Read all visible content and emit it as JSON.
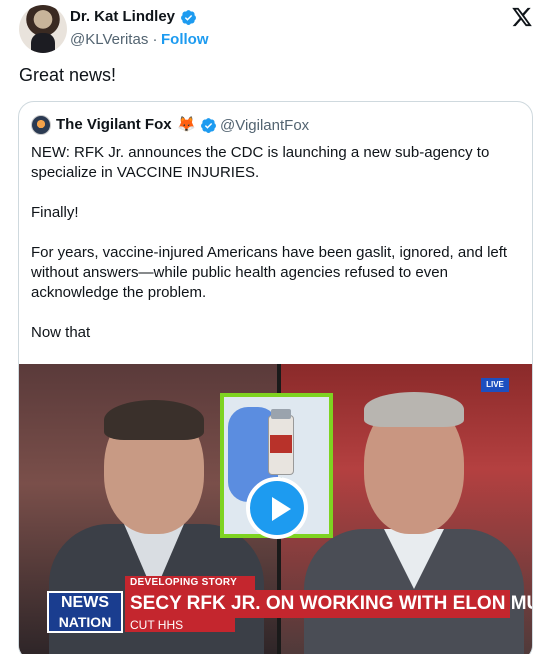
{
  "author": {
    "name": "Dr. Kat Lindley",
    "handle": "@KLVeritas",
    "separator": "·",
    "follow_label": "Follow"
  },
  "tweet": {
    "text": "Great news!"
  },
  "quoted": {
    "name": "The Vigilant Fox",
    "emoji": "🦊",
    "handle": "@VigilantFox",
    "paragraphs": [
      "NEW: RFK Jr. announces the CDC is launching a new sub-agency to specialize in VACCINE INJURIES.",
      "Finally!",
      "For years, vaccine-injured Americans have been gaslit, ignored, and left without answers—while public health agencies refused to even acknowledge the problem.",
      "Now that"
    ]
  },
  "video": {
    "live_badge": "LIVE",
    "chyron_top": "DEVELOPING STORY",
    "chyron_main": "SECY RFK JR. ON WORKING WITH ELON MUSK TO",
    "chyron_sub": "CUT HHS",
    "network_line1": "NEWS",
    "network_line2": "NATION"
  },
  "colors": {
    "accent": "#1d9bf0",
    "verified": "#1d9bf0",
    "chyron_red": "#c4262e",
    "network_blue": "#1a3d8f",
    "inset_border": "#7ed321"
  },
  "icons": {
    "verified": "verified-badge-icon",
    "x_logo": "x-logo-icon",
    "play": "play-icon"
  }
}
